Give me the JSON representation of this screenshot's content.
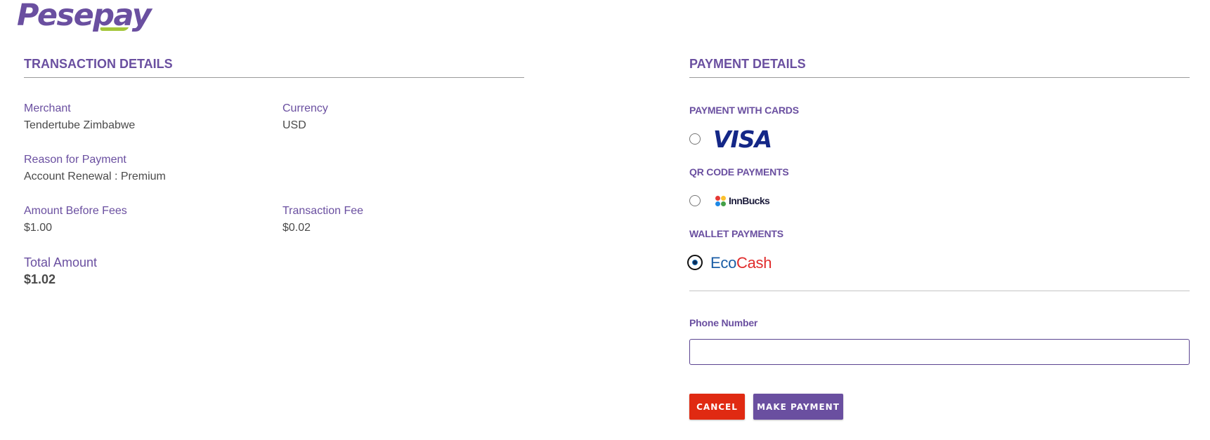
{
  "brand": {
    "name": "Pesepay",
    "primary_color": "#6a4fa0",
    "accent_color": "#a3c639"
  },
  "transaction": {
    "title": "TRANSACTION DETAILS",
    "merchant_label": "Merchant",
    "merchant_value": "Tendertube Zimbabwe",
    "currency_label": "Currency",
    "currency_value": "USD",
    "reason_label": "Reason for Payment",
    "reason_value": "Account Renewal : Premium",
    "amount_label": "Amount Before Fees",
    "amount_value": "$1.00",
    "fee_label": "Transaction Fee",
    "fee_value": "$0.02",
    "total_label": "Total Amount",
    "total_value": "$1.02"
  },
  "payment": {
    "title": "PAYMENT DETAILS",
    "groups": [
      {
        "title": "PAYMENT WITH CARDS",
        "option": "VISA",
        "selected": false,
        "icon": "visa-logo"
      },
      {
        "title": "QR CODE PAYMENTS",
        "option": "InnBucks",
        "selected": false,
        "icon": "innbucks-logo"
      },
      {
        "title": "WALLET PAYMENTS",
        "option_eco": "Eco",
        "option_cash": "Cash",
        "selected": true,
        "icon": "ecocash-logo"
      }
    ],
    "phone_label": "Phone Number",
    "phone_value": "",
    "phone_placeholder": ""
  },
  "actions": {
    "cancel_label": "CANCEL",
    "pay_label": "MAKE PAYMENT",
    "cancel_color": "#e02a12",
    "pay_color": "#6a4fa0"
  }
}
